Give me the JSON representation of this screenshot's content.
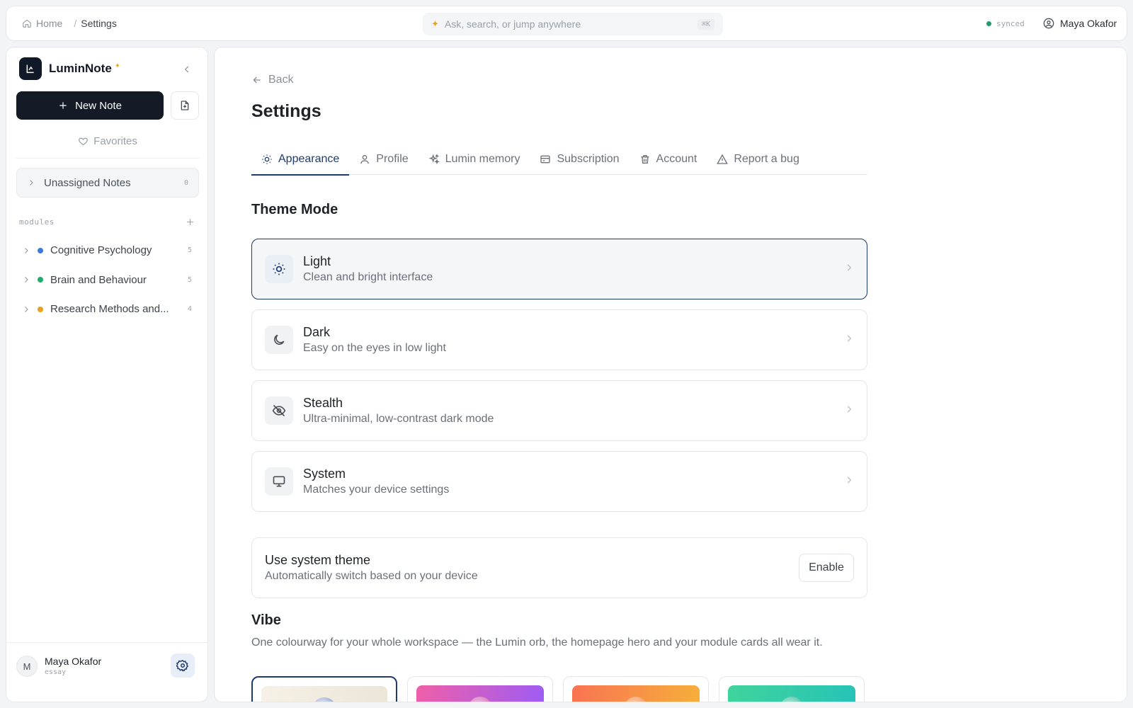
{
  "topbar": {
    "breadcrumb": {
      "home": "Home",
      "separator": "/",
      "current": "Settings"
    },
    "search": {
      "placeholder": "Ask, search, or jump anywhere",
      "shortcut": "⌘K"
    },
    "sync_status": "synced",
    "user_name": "Maya Okafor"
  },
  "sidebar": {
    "app_name": "LuminNote",
    "app_badge": "✦",
    "new_note_label": "New Note",
    "favorites_label": "Favorites",
    "unassigned": {
      "label": "Unassigned Notes",
      "count": "0"
    },
    "modules_label": "modules",
    "modules": [
      {
        "name": "Cognitive Psychology",
        "count": "5",
        "color": "#3b7be0"
      },
      {
        "name": "Brain and Behaviour",
        "count": "5",
        "color": "#1fae6b"
      },
      {
        "name": "Research Methods and...",
        "count": "4",
        "color": "#e8a020"
      }
    ],
    "footer_user": {
      "initial": "M",
      "name": "Maya Okafor",
      "role": "essay"
    }
  },
  "main": {
    "back_label": "Back",
    "title": "Settings",
    "tabs": [
      {
        "label": "Appearance",
        "icon": "sun-icon",
        "active": true
      },
      {
        "label": "Profile",
        "icon": "user-icon"
      },
      {
        "label": "Lumin memory",
        "icon": "sparkles-icon"
      },
      {
        "label": "Subscription",
        "icon": "credit-card-icon"
      },
      {
        "label": "Account",
        "icon": "trash-icon"
      },
      {
        "label": "Report a bug",
        "icon": "warning-icon"
      }
    ],
    "theme_section_title": "Theme Mode",
    "themes": [
      {
        "name": "Light",
        "desc": "Clean and bright interface",
        "icon": "sun-icon",
        "selected": true
      },
      {
        "name": "Dark",
        "desc": "Easy on the eyes in low light",
        "icon": "moon-icon"
      },
      {
        "name": "Stealth",
        "desc": "Ultra-minimal, low-contrast dark mode",
        "icon": "eye-off-icon"
      },
      {
        "name": "System",
        "desc": "Matches your device settings",
        "icon": "monitor-icon"
      }
    ],
    "system_theme": {
      "title": "Use system theme",
      "desc": "Automatically switch based on your device",
      "button": "Enable"
    },
    "vibe_section_title": "Vibe",
    "vibe_desc": "One colourway for your whole workspace — the Lumin orb, the homepage hero and your module cards all wear it.",
    "vibes": [
      {
        "colors": [
          "#f6f1e6",
          "#ebe5d8"
        ],
        "orb": "#6b86c4",
        "selected": true
      },
      {
        "colors": [
          "#f05fa8",
          "#9b5cf6"
        ],
        "orb": "#d45aa0"
      },
      {
        "colors": [
          "#f97352",
          "#f6b13a"
        ],
        "orb": "#f0823a"
      },
      {
        "colors": [
          "#3fd49c",
          "#27c2b8"
        ],
        "orb": "#2bb38f"
      }
    ]
  }
}
